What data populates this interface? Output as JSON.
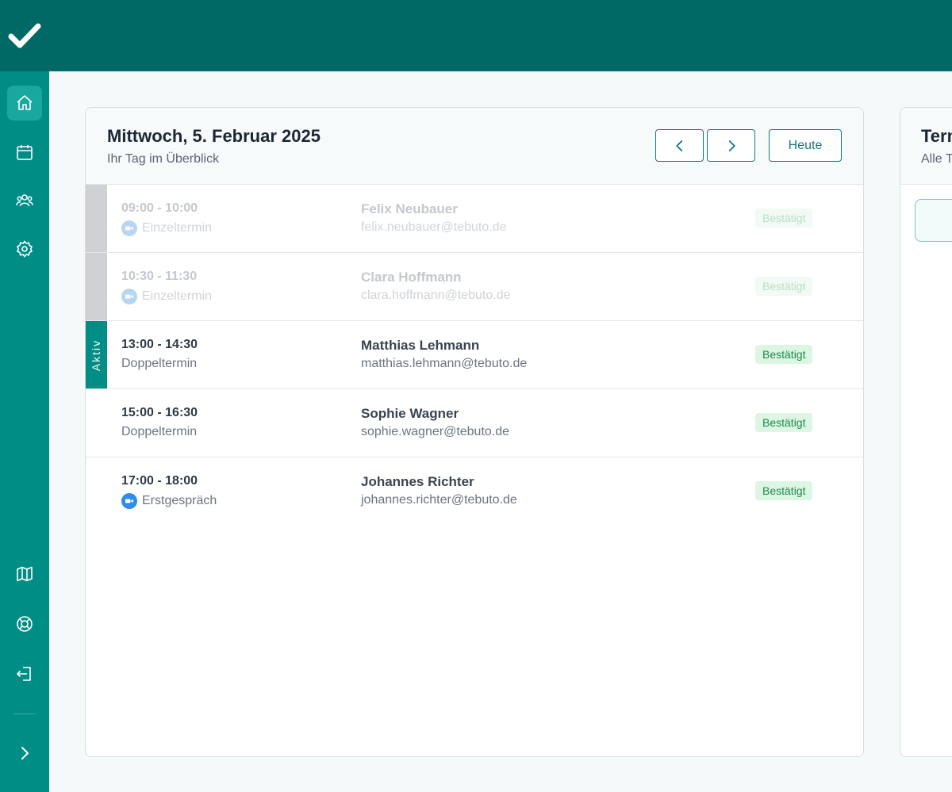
{
  "app": {
    "brand_icon": "check-icon",
    "brand_color": "#006865",
    "sidebar_color": "#008d86"
  },
  "sidebar": {
    "top_items": [
      {
        "icon": "home-icon",
        "active": true
      },
      {
        "icon": "calendar-icon",
        "active": false
      },
      {
        "icon": "users-icon",
        "active": false
      },
      {
        "icon": "gear-icon",
        "active": false
      }
    ],
    "bottom_items": [
      {
        "icon": "map-icon"
      },
      {
        "icon": "lifebuoy-icon"
      },
      {
        "icon": "logout-icon"
      }
    ],
    "expand_icon": "chevron-right-icon"
  },
  "day_card": {
    "title": "Mittwoch, 5. Februar 2025",
    "subtitle": "Ihr Tag im Überblick",
    "prev_icon": "chevron-left-icon",
    "next_icon": "chevron-right-icon",
    "today_label": "Heute",
    "appointments": [
      {
        "time": "09:00 - 10:00",
        "type": "Einzeltermin",
        "video": true,
        "name": "Felix Neubauer",
        "email": "felix.neubauer@tebuto.de",
        "status": "Bestätigt",
        "state": "past"
      },
      {
        "time": "10:30 - 11:30",
        "type": "Einzeltermin",
        "video": true,
        "name": "Clara Hoffmann",
        "email": "clara.hoffmann@tebuto.de",
        "status": "Bestätigt",
        "state": "past"
      },
      {
        "time": "13:00 - 14:30",
        "type": "Doppeltermin",
        "video": false,
        "name": "Matthias Lehmann",
        "email": "matthias.lehmann@tebuto.de",
        "status": "Bestätigt",
        "state": "active",
        "active_label": "Aktiv"
      },
      {
        "time": "15:00 - 16:30",
        "type": "Doppeltermin",
        "video": false,
        "name": "Sophie Wagner",
        "email": "sophie.wagner@tebuto.de",
        "status": "Bestätigt",
        "state": "upcoming"
      },
      {
        "time": "17:00 - 18:00",
        "type": "Erstgespräch",
        "video": true,
        "name": "Johannes Richter",
        "email": "johannes.richter@tebuto.de",
        "status": "Bestätigt",
        "state": "upcoming"
      }
    ]
  },
  "side_card": {
    "title": "Term",
    "subtitle": "Alle T"
  }
}
